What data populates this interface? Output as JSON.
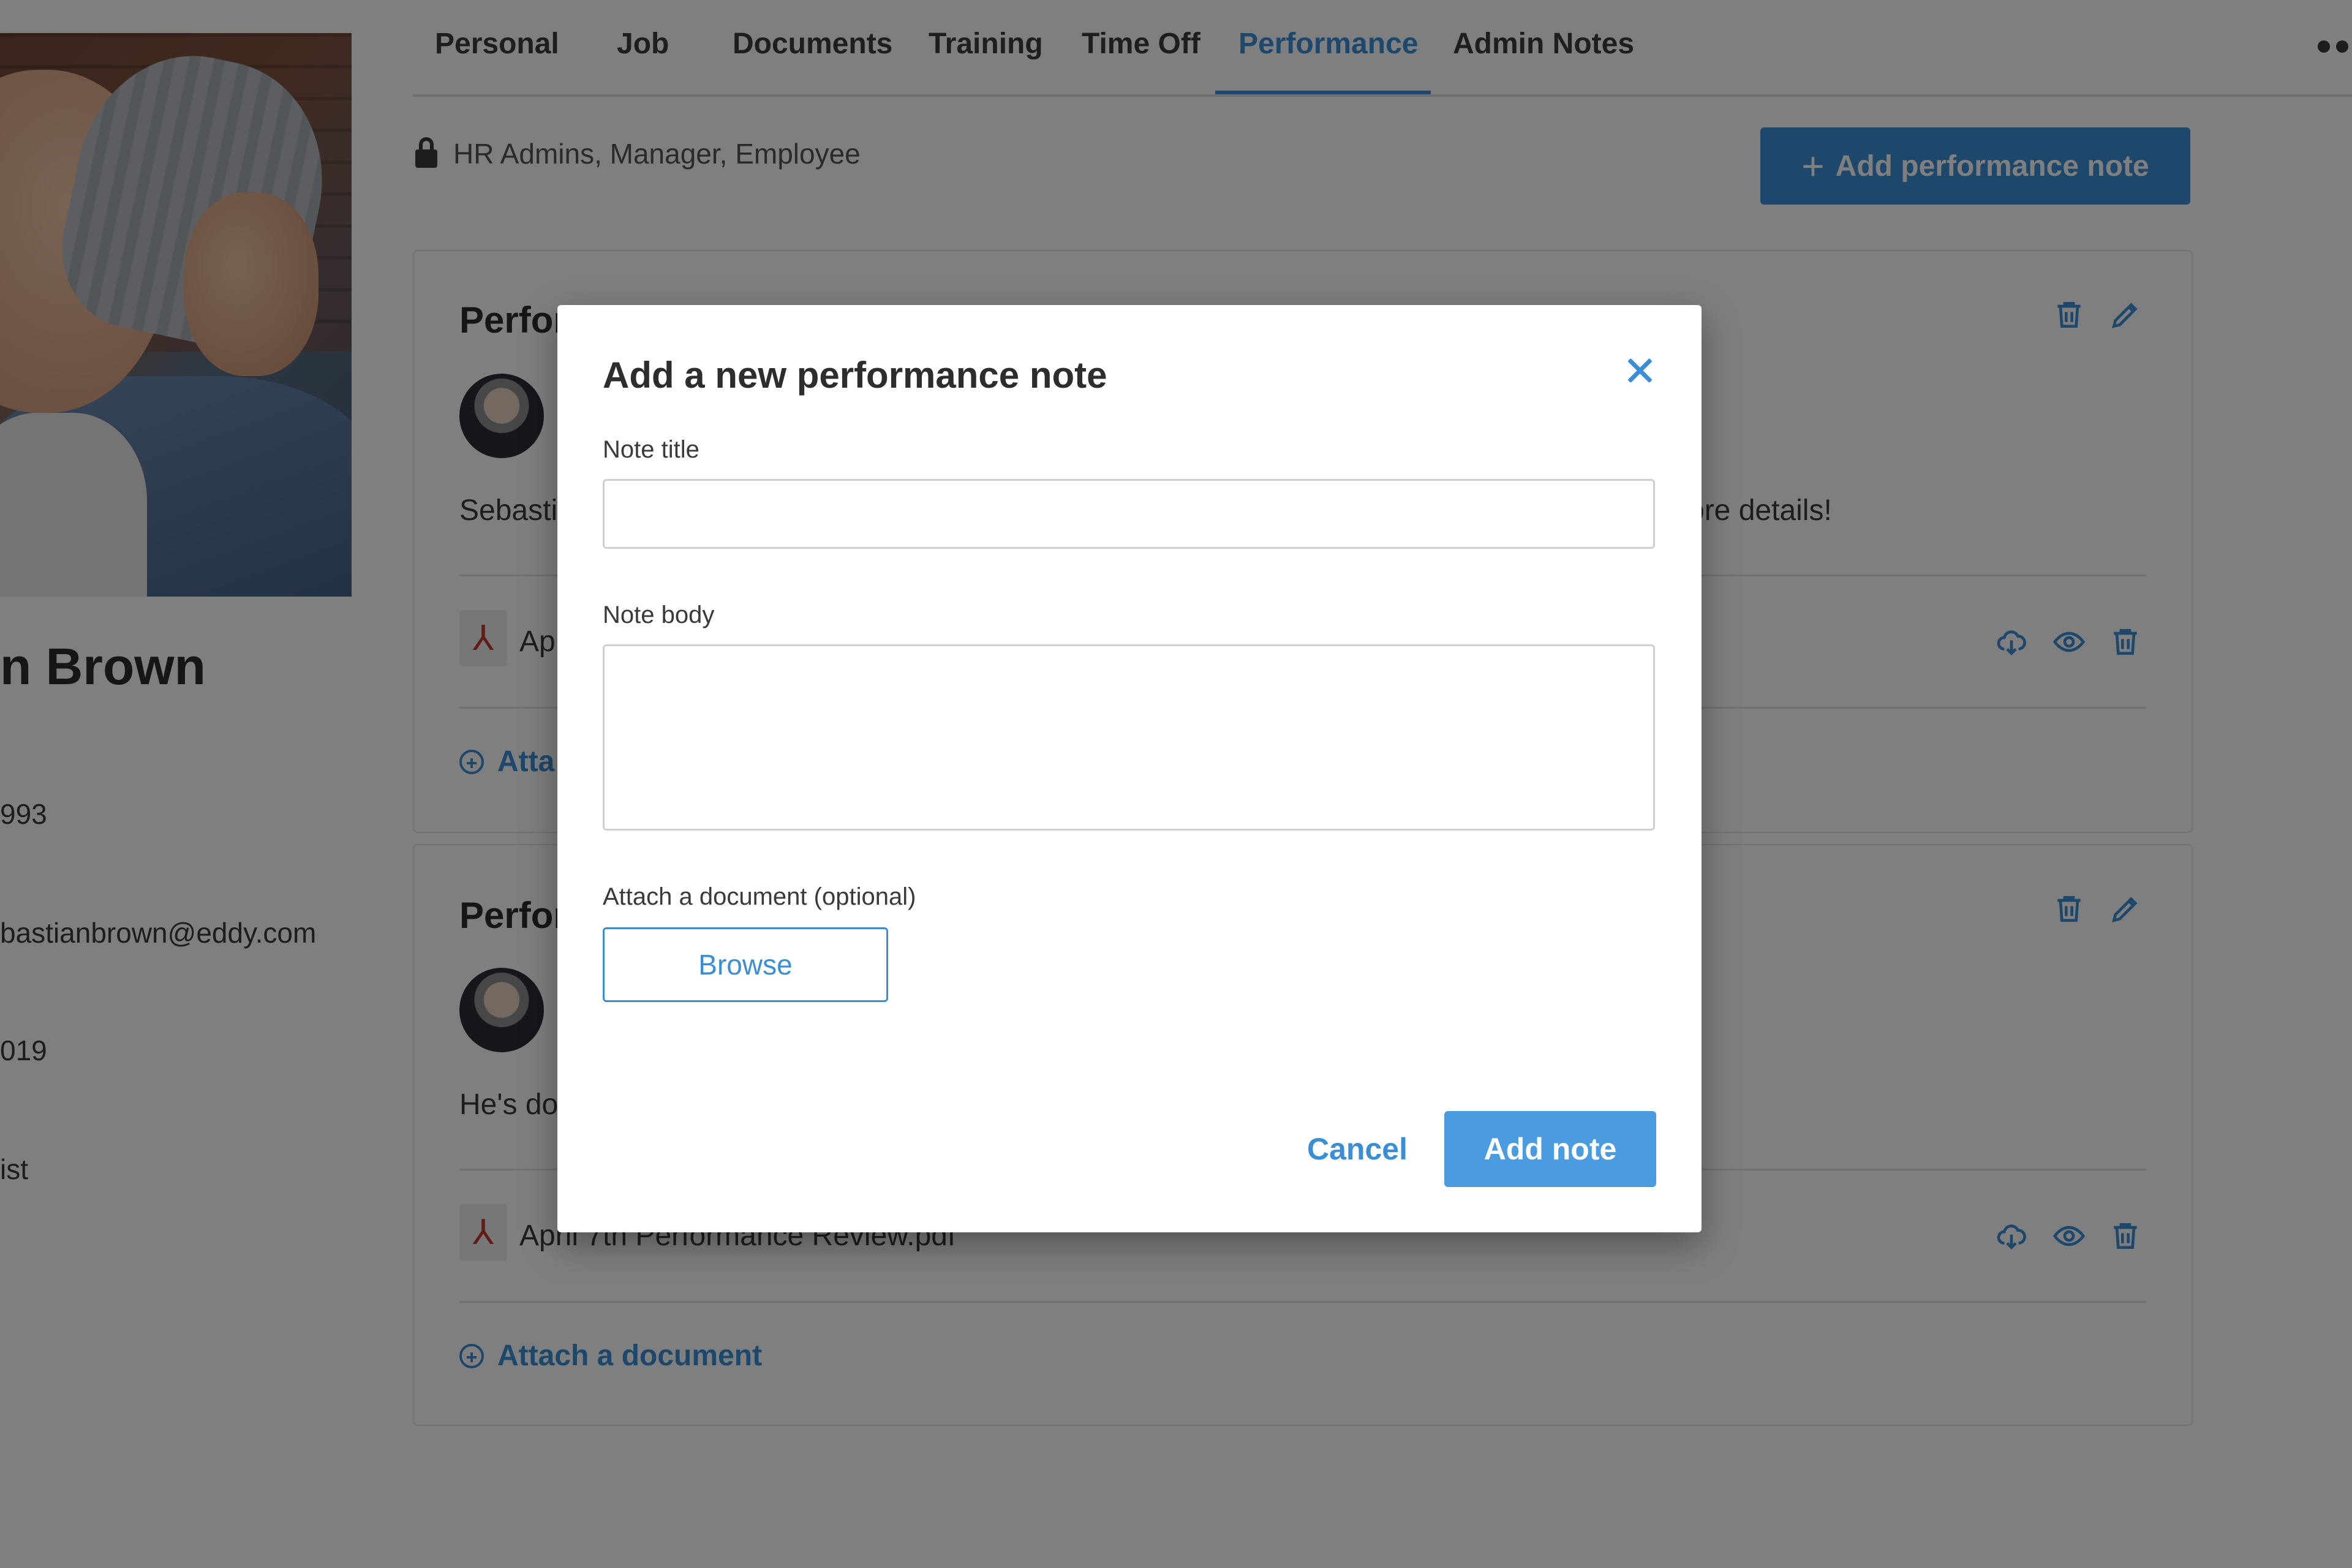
{
  "profile": {
    "name": "n Brown",
    "info_lines": [
      "993",
      "bastianbrown@eddy.com",
      "019",
      "ist"
    ]
  },
  "tabs": [
    {
      "label": "Personal"
    },
    {
      "label": "Job"
    },
    {
      "label": "Documents"
    },
    {
      "label": "Training"
    },
    {
      "label": "Time Off"
    },
    {
      "label": "Performance"
    },
    {
      "label": "Admin Notes"
    }
  ],
  "active_tab": "Performance",
  "visibility": "HR Admins, Manager, Employee",
  "add_note_button": {
    "icon": "+",
    "label": "Add performance note"
  },
  "notes": [
    {
      "title": "Perfor",
      "body_left": "Sebasti",
      "body_right": "ore details!",
      "attachment": "Apr",
      "attach_label": "Atta"
    },
    {
      "title": "Perfor",
      "body_left": "He's doi",
      "attachment": "April 7th Performance Review.pdf",
      "attach_label": "Attach a document"
    }
  ],
  "modal": {
    "title": "Add a new performance note",
    "note_title_label": "Note title",
    "note_title_value": "",
    "note_body_label": "Note body",
    "note_body_value": "",
    "attach_label": "Attach a document (optional)",
    "browse_label": "Browse",
    "cancel_label": "Cancel",
    "submit_label": "Add note"
  },
  "colors": {
    "accent": "#3a8ed6",
    "overlay": "rgba(0,0,0,0.5)",
    "pdf_red": "#c0392b"
  }
}
